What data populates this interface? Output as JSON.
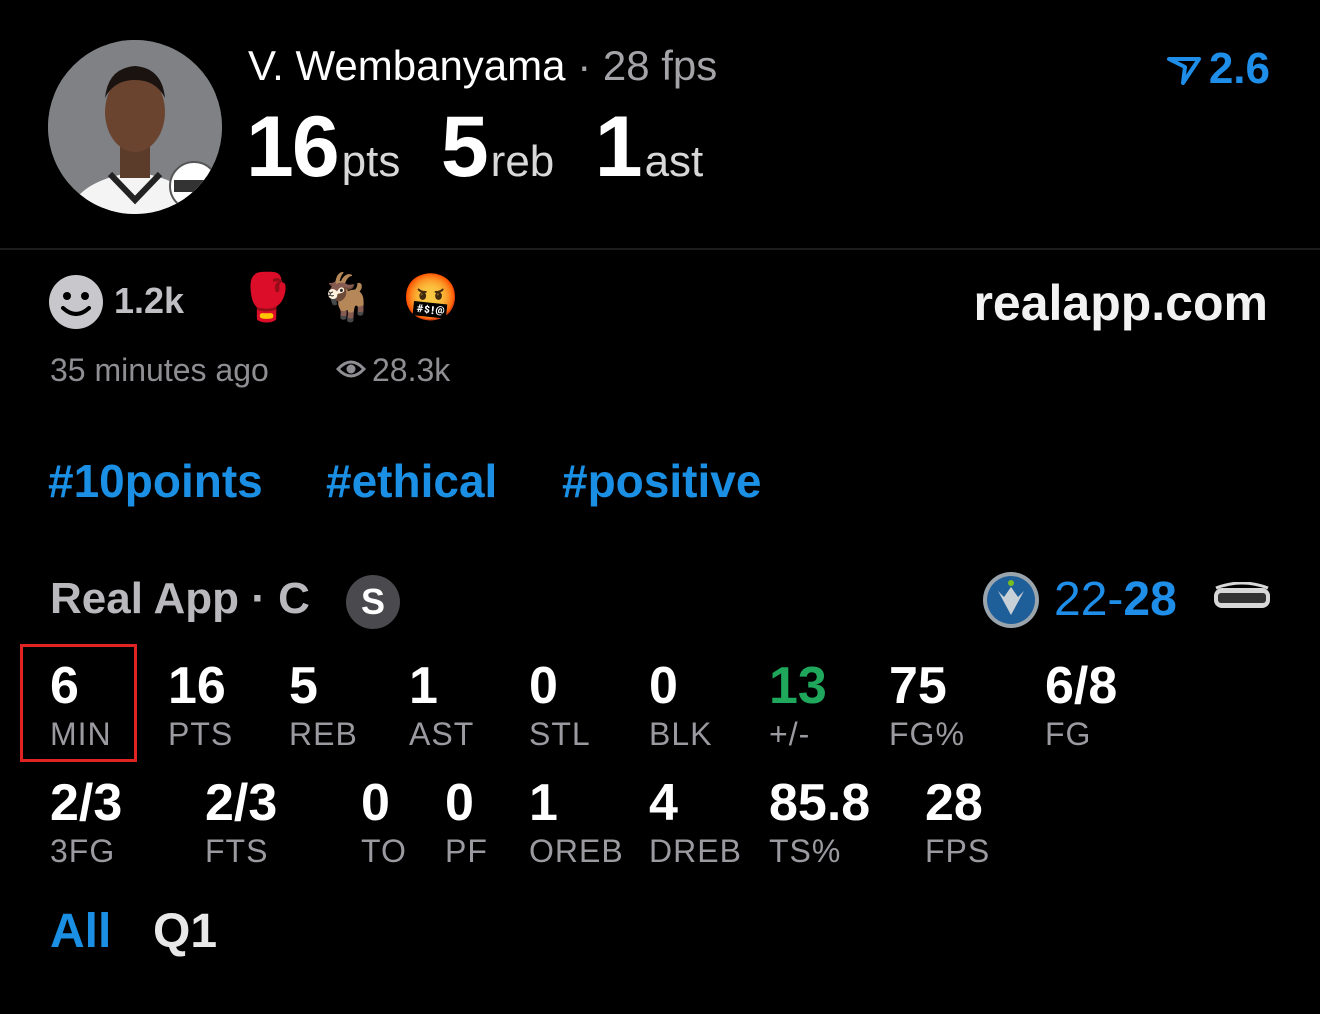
{
  "header": {
    "player_name": "V. Wembanyama",
    "separator": "·",
    "fps_text": "28 fps",
    "points": "16",
    "points_unit": "pts",
    "rebounds": "5",
    "rebounds_unit": "reb",
    "assists": "1",
    "assists_unit": "ast",
    "rating": "2.6",
    "accent_color": "#1e8ee8"
  },
  "reactions": {
    "count": "1.2k",
    "emojis": [
      "🥊",
      "🐐",
      "🤬"
    ],
    "site": "realapp.com",
    "time_ago": "35 minutes ago",
    "views": "28.3k"
  },
  "hashtags": [
    "#10points",
    "#ethical",
    "#positive"
  ],
  "team": {
    "line": "Real App · C",
    "badge": "S",
    "score_left": "22",
    "score_sep": "-",
    "score_right": "28"
  },
  "stats_row1": [
    {
      "value": "6",
      "label": "MIN"
    },
    {
      "value": "16",
      "label": "PTS"
    },
    {
      "value": "5",
      "label": "REB"
    },
    {
      "value": "1",
      "label": "AST"
    },
    {
      "value": "0",
      "label": "STL"
    },
    {
      "value": "0",
      "label": "BLK"
    },
    {
      "value": "13",
      "label": "+/-"
    },
    {
      "value": "75",
      "label": "FG%"
    },
    {
      "value": "6/8",
      "label": "FG"
    }
  ],
  "stats_row2": [
    {
      "value": "2/3",
      "label": "3FG"
    },
    {
      "value": "2/3",
      "label": "FTS"
    },
    {
      "value": "0",
      "label": "TO"
    },
    {
      "value": "0",
      "label": "PF"
    },
    {
      "value": "1",
      "label": "OREB"
    },
    {
      "value": "4",
      "label": "DREB"
    },
    {
      "value": "85.8",
      "label": "TS%"
    },
    {
      "value": "28",
      "label": "FPS"
    }
  ],
  "tabs": {
    "all": "All",
    "q1": "Q1"
  }
}
